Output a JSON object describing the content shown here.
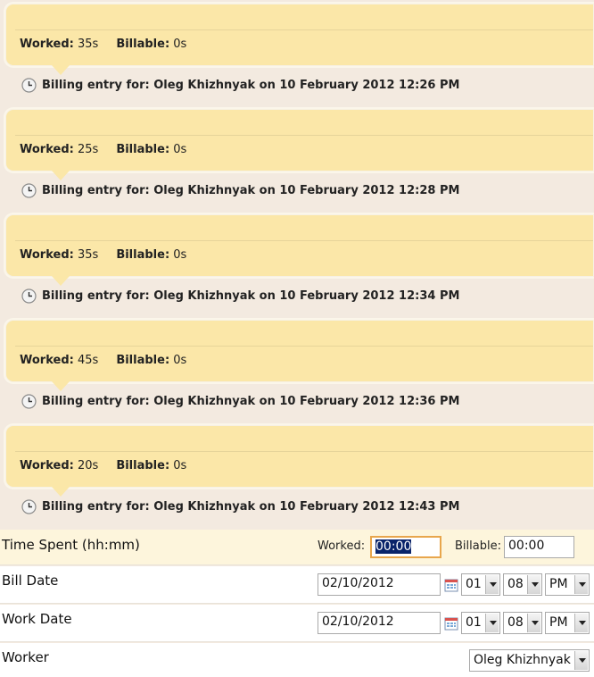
{
  "entries": [
    {
      "worked_label": "Worked:",
      "worked": "35s",
      "billable_label": "Billable:",
      "billable": "0s",
      "meta": "Billing entry for: Oleg Khizhnyak on 10 February 2012 12:26 PM"
    },
    {
      "worked_label": "Worked:",
      "worked": "25s",
      "billable_label": "Billable:",
      "billable": "0s",
      "meta": "Billing entry for: Oleg Khizhnyak on 10 February 2012 12:28 PM"
    },
    {
      "worked_label": "Worked:",
      "worked": "35s",
      "billable_label": "Billable:",
      "billable": "0s",
      "meta": "Billing entry for: Oleg Khizhnyak on 10 February 2012 12:34 PM"
    },
    {
      "worked_label": "Worked:",
      "worked": "45s",
      "billable_label": "Billable:",
      "billable": "0s",
      "meta": "Billing entry for: Oleg Khizhnyak on 10 February 2012 12:36 PM"
    },
    {
      "worked_label": "Worked:",
      "worked": "20s",
      "billable_label": "Billable:",
      "billable": "0s",
      "meta": "Billing entry for: Oleg Khizhnyak on 10 February 2012 12:43 PM"
    }
  ],
  "form": {
    "time_spent": {
      "label": "Time Spent (hh:mm)",
      "worked_label": "Worked:",
      "worked_value": "00:00",
      "billable_label": "Billable:",
      "billable_value": "00:00"
    },
    "bill_date": {
      "label": "Bill Date",
      "date": "02/10/2012",
      "hour": "01",
      "minute": "08",
      "ampm": "PM"
    },
    "work_date": {
      "label": "Work Date",
      "date": "02/10/2012",
      "hour": "01",
      "minute": "08",
      "ampm": "PM"
    },
    "worker": {
      "label": "Worker",
      "value": "Oleg Khizhnyak"
    }
  },
  "icons": {
    "entry_meta": "clock-icon",
    "date_picker": "calendar-icon",
    "dropdown": "chevron-down-icon"
  },
  "colors": {
    "background": "#f3eae0",
    "bubble": "#fbe7a8",
    "focus_border": "#e8a64c",
    "selection": "#0a246a"
  }
}
